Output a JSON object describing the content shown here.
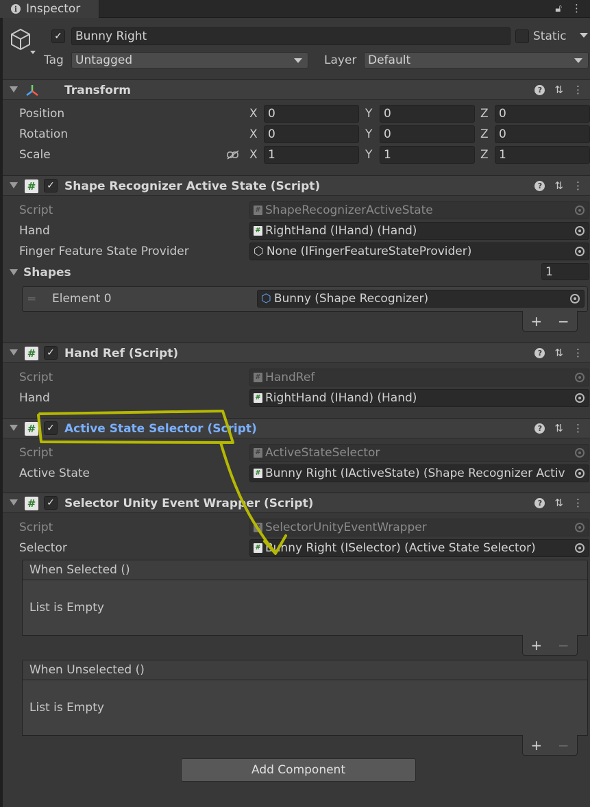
{
  "window": {
    "tab_label": "Inspector"
  },
  "object": {
    "enabled": true,
    "name": "Bunny Right",
    "static_label": "Static",
    "tag_label": "Tag",
    "tag_value": "Untagged",
    "layer_label": "Layer",
    "layer_value": "Default"
  },
  "transform": {
    "title": "Transform",
    "rows": [
      {
        "label": "Position",
        "x": "0",
        "y": "0",
        "z": "0"
      },
      {
        "label": "Rotation",
        "x": "0",
        "y": "0",
        "z": "0"
      },
      {
        "label": "Scale",
        "x": "1",
        "y": "1",
        "z": "1"
      }
    ],
    "axes": {
      "x": "X",
      "y": "Y",
      "z": "Z"
    }
  },
  "shape_recognizer": {
    "title": "Shape Recognizer Active State (Script)",
    "script_label": "Script",
    "script_value": "ShapeRecognizerActiveState",
    "hand_label": "Hand",
    "hand_value": "RightHand (IHand) (Hand)",
    "ffsp_label": "Finger Feature State Provider",
    "ffsp_value": "None (IFingerFeatureStateProvider)",
    "shapes_label": "Shapes",
    "shapes_count": "1",
    "element_label": "Element 0",
    "element_value": "Bunny (Shape Recognizer)",
    "plus": "+",
    "minus": "−"
  },
  "hand_ref": {
    "title": "Hand Ref (Script)",
    "script_label": "Script",
    "script_value": "HandRef",
    "hand_label": "Hand",
    "hand_value": "RightHand (IHand) (Hand)"
  },
  "active_state_selector": {
    "title": "Active State Selector (Script)",
    "script_label": "Script",
    "script_value": "ActiveStateSelector",
    "active_state_label": "Active State",
    "active_state_value": "Bunny Right (IActiveState) (Shape Recognizer Activ"
  },
  "selector_wrapper": {
    "title": "Selector Unity Event Wrapper (Script)",
    "script_label": "Script",
    "script_value": "SelectorUnityEventWrapper",
    "selector_label": "Selector",
    "selector_value": "Bunny Right (ISelector) (Active State Selector)",
    "when_selected": "When Selected ()",
    "when_unselected": "When Unselected ()",
    "empty_text": "List is Empty",
    "plus": "+",
    "minus": "−"
  },
  "add_component_label": "Add Component",
  "icons": {
    "help": "?",
    "presets": "⇅",
    "menu": "⋮",
    "check": "✓",
    "hash": "#"
  },
  "colors": {
    "panel_bg": "#383838",
    "link_blue": "#7ab0ff",
    "annotation": "#b5b800"
  }
}
